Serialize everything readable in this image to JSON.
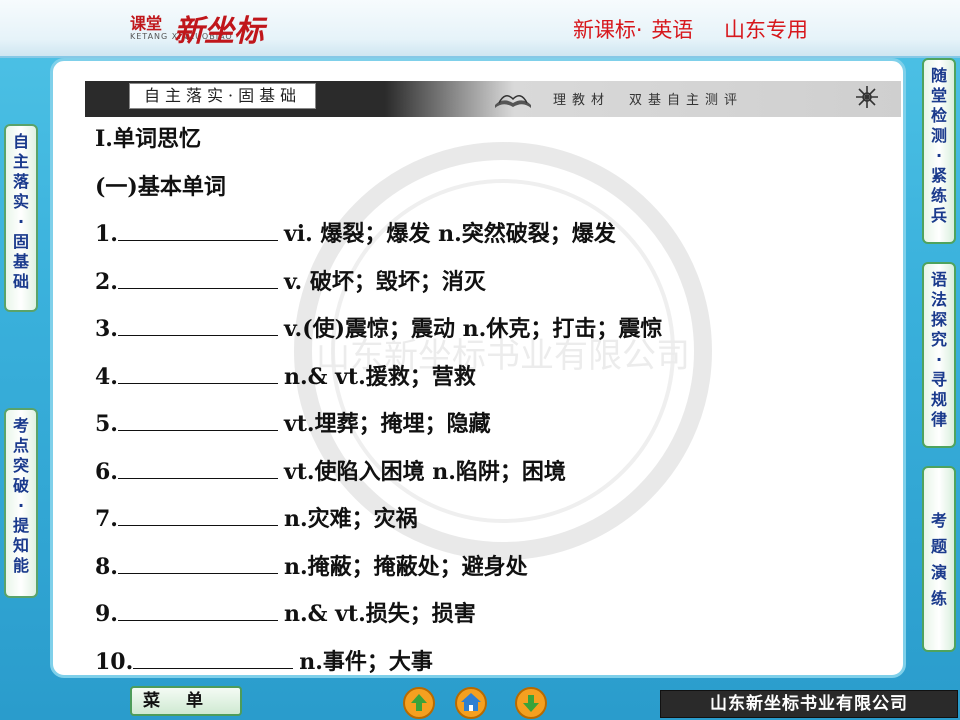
{
  "header": {
    "logo_small": "课堂",
    "logo_pinyin": "KETANG XINZUOBIAO",
    "logo_big": "新坐标",
    "series": "新课标·",
    "subject": "英语",
    "region": "山东专用"
  },
  "banner": {
    "title": "自主落实·固基础",
    "subtitle": "理教材　双基自主测评"
  },
  "content": {
    "section": "I.单词思忆",
    "subsection": "(一)基本单词",
    "items": [
      {
        "num": "1.",
        "def": "vi. 爆裂；爆发 n.突然破裂；爆发"
      },
      {
        "num": "2.",
        "def": "v. 破坏；毁坏；消灭"
      },
      {
        "num": "3.",
        "def": "v.(使)震惊；震动 n.休克；打击；震惊"
      },
      {
        "num": "4.",
        "def": "n.& vt.援救；营救"
      },
      {
        "num": "5.",
        "def": "vt.埋葬；掩埋；隐藏"
      },
      {
        "num": "6.",
        "def": "vt.使陷入困境 n.陷阱；困境"
      },
      {
        "num": "7.",
        "def": "n.灾难；灾祸"
      },
      {
        "num": "8.",
        "def": "n.掩蔽；掩蔽处；避身处"
      },
      {
        "num": "9.",
        "def": "n.& vt.损失；损害"
      },
      {
        "num": "10.",
        "def": "n.事件；大事"
      }
    ]
  },
  "watermark_text": "山东新坐标书业有限公司",
  "side_left": [
    {
      "label": "自主落实·固基础"
    },
    {
      "label": "考点突破·提知能"
    }
  ],
  "side_right": [
    {
      "label": "随堂检测·紧练兵"
    },
    {
      "label": "语法探究·寻规律"
    },
    {
      "label": "考题演练"
    }
  ],
  "footer": {
    "menu_label": "菜单",
    "company": "山东新坐标书业有限公司"
  },
  "colors": {
    "background": "#3ab1dc",
    "accent_red": "#d7171c",
    "side_text": "#1a3a8c",
    "side_border": "#4ea35e"
  },
  "icons": [
    "book-icon",
    "snowflake-icon",
    "back-arrow-icon",
    "home-icon",
    "forward-arrow-icon"
  ]
}
